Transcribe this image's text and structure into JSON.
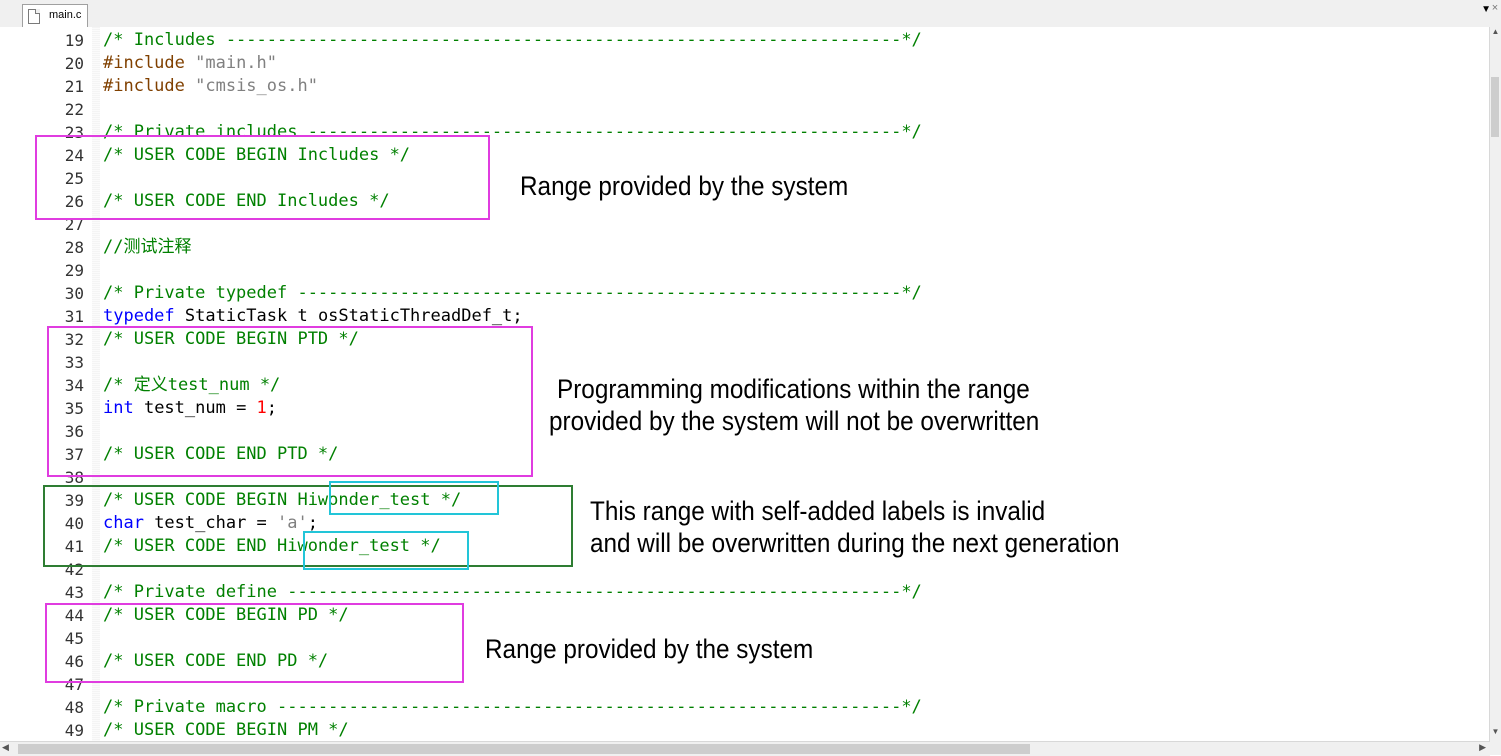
{
  "tab": {
    "label": "main.c",
    "dropdown": "▼",
    "close": "×"
  },
  "lines": [
    {
      "n": "19",
      "parts": [
        {
          "t": "/* Includes ------------------------------------------------------------------*/",
          "c": "comment"
        }
      ]
    },
    {
      "n": "20",
      "parts": [
        {
          "t": "#include ",
          "c": "pp"
        },
        {
          "t": "\"main.h\"",
          "c": "str"
        }
      ]
    },
    {
      "n": "21",
      "parts": [
        {
          "t": "#include ",
          "c": "pp"
        },
        {
          "t": "\"cmsis_os.h\"",
          "c": "str"
        }
      ]
    },
    {
      "n": "22",
      "parts": []
    },
    {
      "n": "23",
      "parts": [
        {
          "t": "/* Private includes ----------------------------------------------------------*/",
          "c": "comment"
        }
      ]
    },
    {
      "n": "24",
      "parts": [
        {
          "t": "/* USER CODE BEGIN Includes */",
          "c": "comment"
        }
      ]
    },
    {
      "n": "25",
      "parts": []
    },
    {
      "n": "26",
      "parts": [
        {
          "t": "/* USER CODE END Includes */",
          "c": "comment"
        }
      ]
    },
    {
      "n": "27",
      "parts": []
    },
    {
      "n": "28",
      "parts": [
        {
          "t": "//测试注释",
          "c": "comment"
        }
      ]
    },
    {
      "n": "29",
      "parts": []
    },
    {
      "n": "30",
      "parts": [
        {
          "t": "/* Private typedef -----------------------------------------------------------*/",
          "c": "comment"
        }
      ]
    },
    {
      "n": "31",
      "parts": [
        {
          "t": "typedef",
          "c": "kw"
        },
        {
          "t": " StaticTask t osStaticThreadDef_t;",
          "c": "def"
        }
      ]
    },
    {
      "n": "32",
      "parts": [
        {
          "t": "/* USER CODE BEGIN PTD */",
          "c": "comment"
        }
      ]
    },
    {
      "n": "33",
      "parts": []
    },
    {
      "n": "34",
      "parts": [
        {
          "t": "/* 定义test_num */",
          "c": "comment"
        }
      ]
    },
    {
      "n": "35",
      "parts": [
        {
          "t": "int",
          "c": "kw"
        },
        {
          "t": " test_num = ",
          "c": "def"
        },
        {
          "t": "1",
          "c": "num"
        },
        {
          "t": ";",
          "c": "def"
        }
      ]
    },
    {
      "n": "36",
      "parts": []
    },
    {
      "n": "37",
      "parts": [
        {
          "t": "/* USER CODE END PTD */",
          "c": "comment"
        }
      ]
    },
    {
      "n": "38",
      "parts": []
    },
    {
      "n": "39",
      "parts": [
        {
          "t": "/* USER CODE BEGIN Hiwonder_test */",
          "c": "comment"
        }
      ]
    },
    {
      "n": "40",
      "parts": [
        {
          "t": "char",
          "c": "kw"
        },
        {
          "t": " test_char = ",
          "c": "def"
        },
        {
          "t": "'a'",
          "c": "str"
        },
        {
          "t": ";",
          "c": "def"
        }
      ]
    },
    {
      "n": "41",
      "parts": [
        {
          "t": "/* USER CODE END Hiwonder_test */",
          "c": "comment"
        }
      ]
    },
    {
      "n": "42",
      "parts": []
    },
    {
      "n": "43",
      "parts": [
        {
          "t": "/* Private define ------------------------------------------------------------*/",
          "c": "comment"
        }
      ]
    },
    {
      "n": "44",
      "parts": [
        {
          "t": "/* USER CODE BEGIN PD */",
          "c": "comment"
        }
      ]
    },
    {
      "n": "45",
      "parts": []
    },
    {
      "n": "46",
      "parts": [
        {
          "t": "/* USER CODE END PD */",
          "c": "comment"
        }
      ]
    },
    {
      "n": "47",
      "parts": []
    },
    {
      "n": "48",
      "parts": [
        {
          "t": "/* Private macro -------------------------------------------------------------*/",
          "c": "comment"
        }
      ]
    },
    {
      "n": "49",
      "parts": [
        {
          "t": "/* USER CODE BEGIN PM */",
          "c": "comment"
        }
      ]
    }
  ],
  "annotations": {
    "includes_range": "Range provided by the system",
    "ptd_line1": "Programming modifications within the range",
    "ptd_line2": "provided by the system will not be overwritten",
    "custom_line1": "This range with self-added labels is invalid",
    "custom_line2": "and will be overwritten during the next generation",
    "pd_range": "Range provided by the system"
  },
  "colors": {
    "comment": "#008000",
    "keyword": "#0000ff",
    "preprocessor": "#804000",
    "string": "#808080",
    "number": "#ff0000",
    "box_magenta": "#e03ce0",
    "box_green": "#2e7d32",
    "box_cyan": "#22c5d8"
  }
}
